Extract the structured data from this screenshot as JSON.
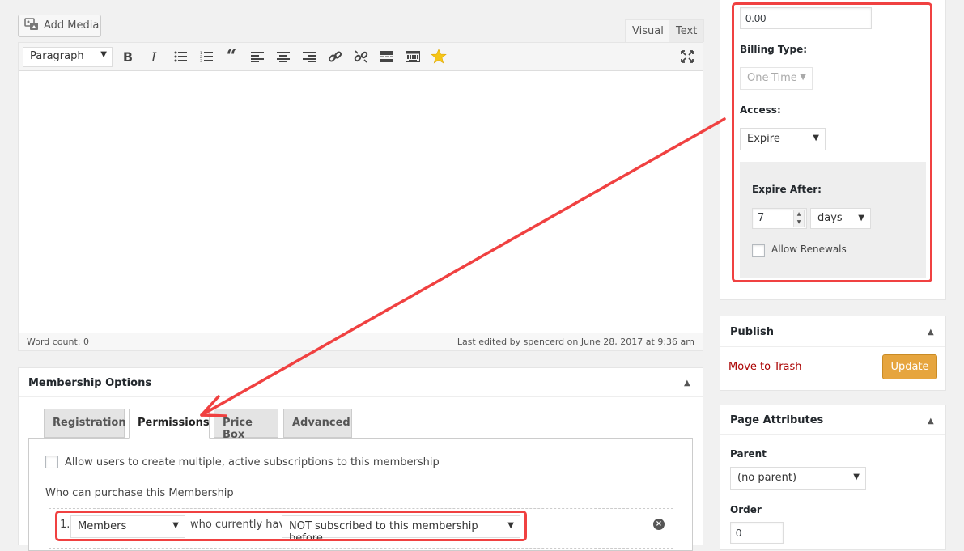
{
  "editor": {
    "add_media_label": "Add Media",
    "tabs": {
      "visual": "Visual",
      "text": "Text"
    },
    "format_select": "Paragraph",
    "toolbar_icons": [
      "bold-icon",
      "italic-icon",
      "bullet-list-icon",
      "numbered-list-icon",
      "blockquote-icon",
      "align-left-icon",
      "align-center-icon",
      "align-right-icon",
      "link-icon",
      "unlink-icon",
      "read-more-icon",
      "toolbar-toggle-icon",
      "star-icon",
      "fullscreen-icon"
    ],
    "word_count": "Word count: 0",
    "last_edited": "Last edited by spencerd on June 28, 2017 at 9:36 am"
  },
  "membership": {
    "title": "Membership Options",
    "tabs": [
      "Registration",
      "Permissions",
      "Price Box",
      "Advanced"
    ],
    "active_tab": "Permissions",
    "allow_multiple_label": "Allow users to create multiple, active subscriptions to this membership",
    "who_can_purchase": "Who can purchase this Membership",
    "rule": {
      "number": "1.",
      "who": "Members",
      "connector": "who currently have",
      "condition": "NOT subscribed to this membership before"
    }
  },
  "pricing": {
    "price_value": "0.00",
    "billing_type_label": "Billing Type:",
    "billing_type_value": "One-Time",
    "access_label": "Access:",
    "access_value": "Expire",
    "expire_after_label": "Expire After:",
    "expire_after_value": "7",
    "expire_unit": "days",
    "allow_renewals_label": "Allow Renewals"
  },
  "publish": {
    "title": "Publish",
    "move_to_trash": "Move to Trash",
    "update_label": "Update"
  },
  "page_attributes": {
    "title": "Page Attributes",
    "parent_label": "Parent",
    "parent_value": "(no parent)",
    "order_label": "Order",
    "order_value": "0"
  },
  "colors": {
    "annotation_red": "#f04141",
    "update_button": "#e6a53e",
    "trash_link": "#a00"
  }
}
